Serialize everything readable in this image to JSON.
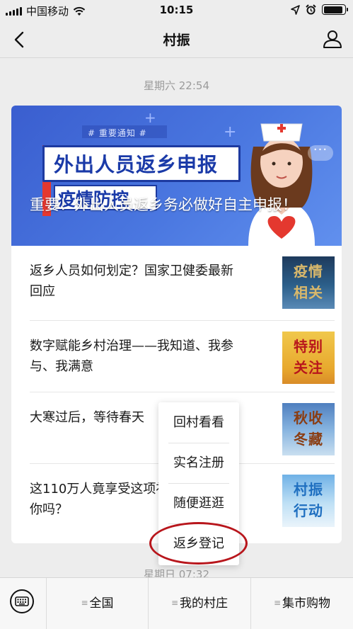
{
  "status_bar": {
    "carrier": "中国移动",
    "time": "10:15",
    "battery_level": 0.9
  },
  "nav": {
    "title": "村振",
    "back_icon": "chevron-left-icon",
    "profile_icon": "user-icon"
  },
  "timestamps": {
    "top": "星期六 22:54",
    "bottom": "星期日 07:32"
  },
  "banner": {
    "notice": "# 重要通知 #",
    "headline": "外出人员返乡申报",
    "subhead": "疫情防控",
    "title": "重要！外出人员返乡务必做好自主申报！",
    "more": "···"
  },
  "articles": [
    {
      "title": "返乡人员如何划定？国家卫健委最新回应",
      "thumb": "疫情\n相关"
    },
    {
      "title": "数字赋能乡村治理——我知道、我参与、我满意",
      "thumb": "特别\n关注"
    },
    {
      "title": "大寒过后，等待春天",
      "thumb": "秋收\n冬藏"
    },
    {
      "title": "这110万人竟享受这项补贴，看看有你吗？",
      "thumb": "村振\n行动"
    }
  ],
  "popup_menu": {
    "items": [
      "回村看看",
      "实名注册",
      "随便逛逛",
      "返乡登记"
    ],
    "highlighted": "返乡登记"
  },
  "bottom_bar": {
    "keyboard_icon": "keyboard-icon",
    "tabs": [
      "全国",
      "我的村庄",
      "集市购物"
    ]
  },
  "colors": {
    "accent_red": "#b8161c",
    "banner_blue": "#4a77e0"
  }
}
